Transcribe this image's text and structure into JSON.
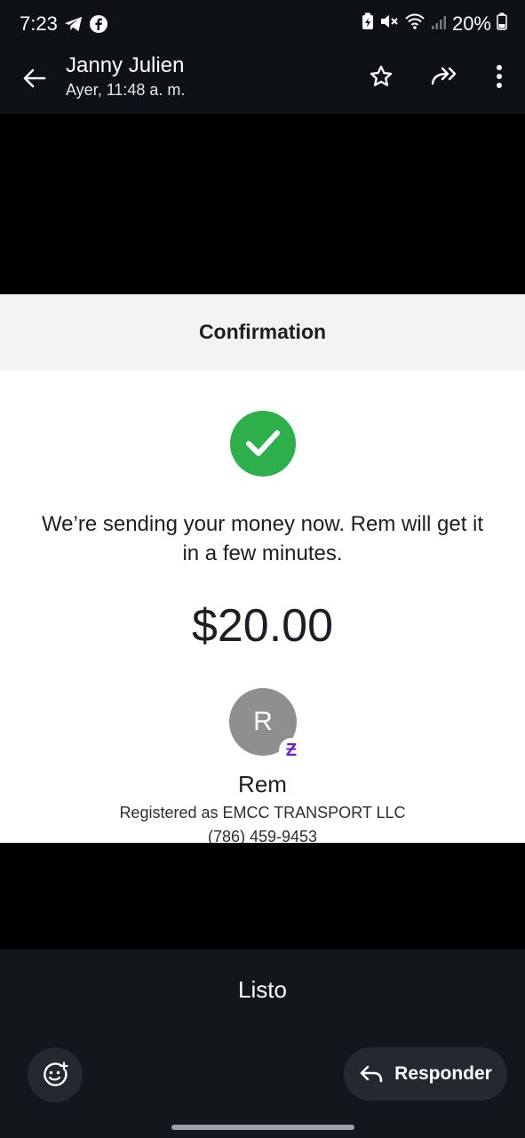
{
  "status_bar": {
    "time": "7:23",
    "battery": "20%",
    "left_icons": [
      "telegram-icon",
      "facebook-icon"
    ],
    "right_icons": [
      "battery-saver-icon",
      "mute-icon",
      "wifi-icon",
      "signal-icon",
      "battery-icon"
    ]
  },
  "app_bar": {
    "sender": "Janny Julien",
    "time": "Ayer, 11:48 a. m.",
    "actions": [
      "star-icon",
      "forward-icon",
      "more-icon"
    ]
  },
  "receipt": {
    "header": "Confirmation",
    "message": "We’re sending your money now. Rem will get it in a few minutes.",
    "amount": "$20.00",
    "avatar_initial": "R",
    "badge": "Ƶ",
    "recipient_name": "Rem",
    "registered": "Registered as EMCC TRANSPORT LLC",
    "phone": "(786) 459-9453",
    "colors": {
      "success": "#2db04b",
      "brand": "#6d1ed4"
    }
  },
  "bottom_bar": {
    "caption": "Listo",
    "reply_label": "Responder"
  }
}
